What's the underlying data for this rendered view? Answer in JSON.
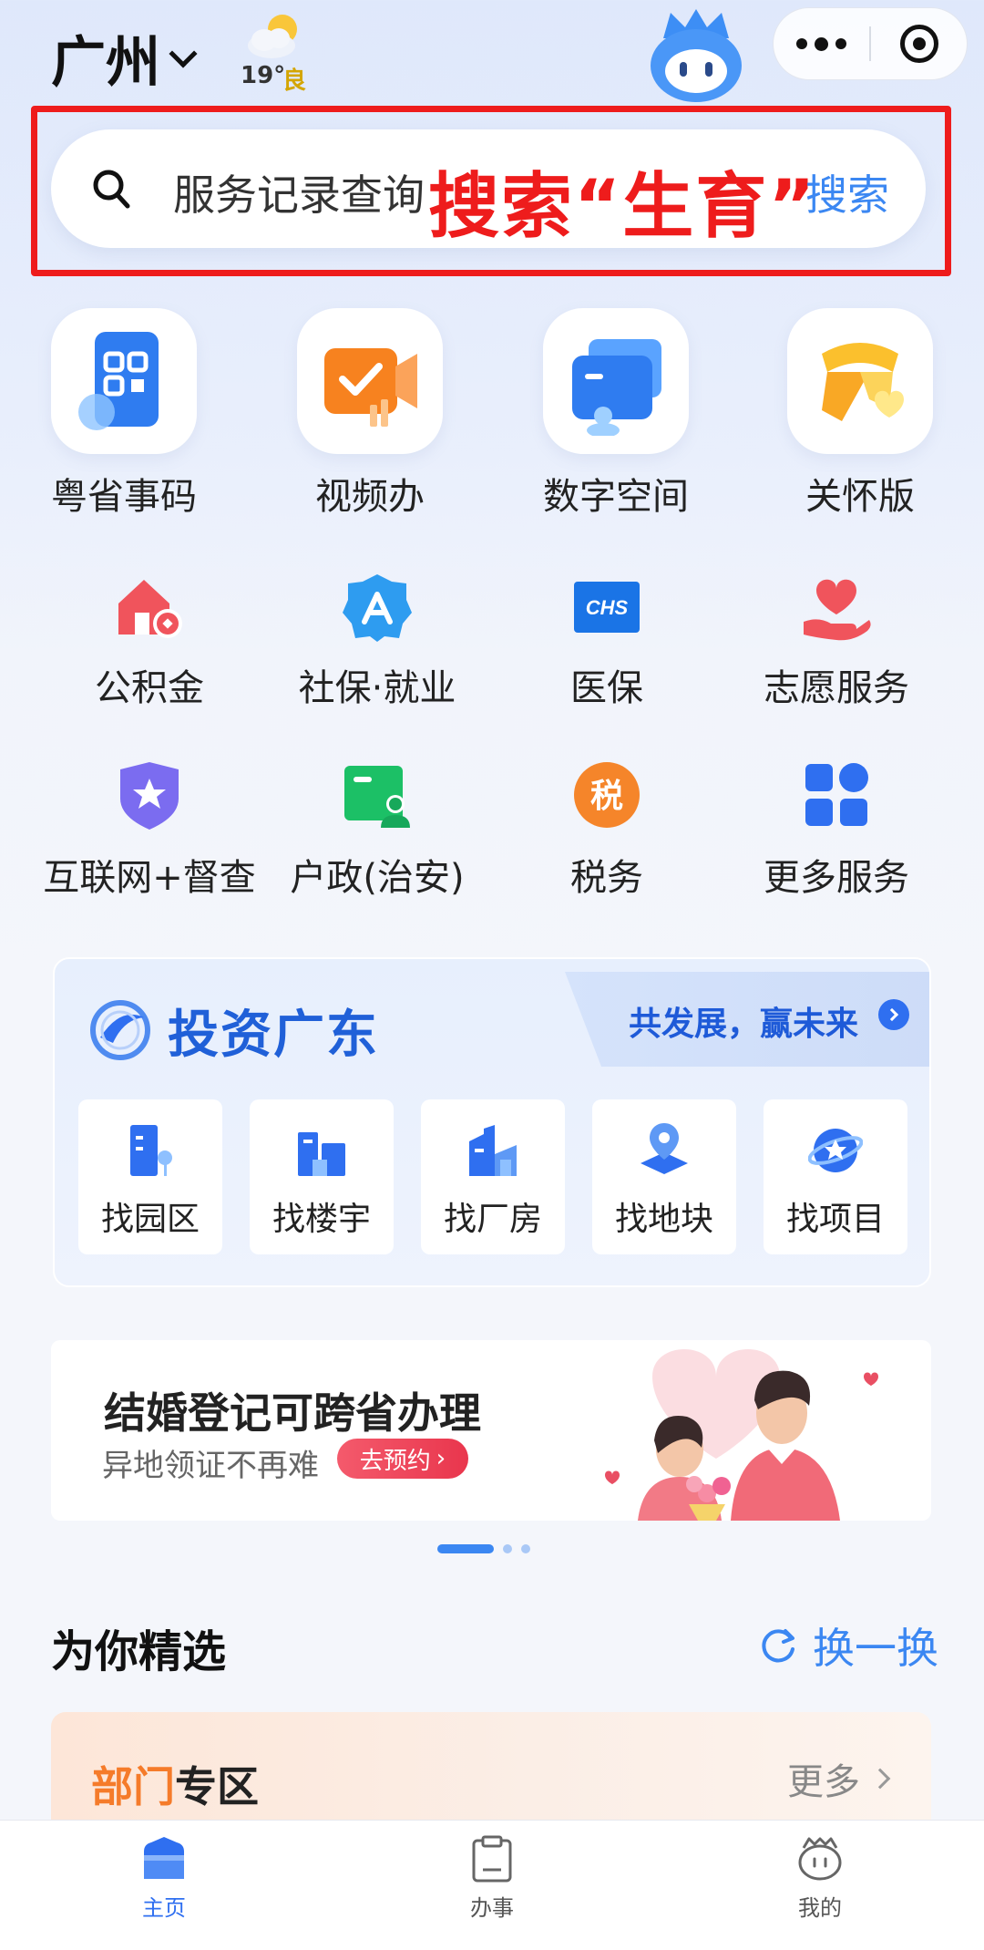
{
  "header": {
    "city": "广州",
    "weather_temp": "19°",
    "air_quality": "良"
  },
  "search": {
    "placeholder": "服务记录查询",
    "annotation": "搜索“生育”",
    "button_label": "搜索"
  },
  "quick_services": [
    {
      "label": "粤省事码",
      "icon": "qr-code-icon"
    },
    {
      "label": "视频办",
      "icon": "video-camera-icon"
    },
    {
      "label": "数字空间",
      "icon": "wallet-icon"
    },
    {
      "label": "关怀版",
      "icon": "scarf-heart-icon"
    }
  ],
  "services": [
    {
      "label": "公积金",
      "icon": "house-fund-icon",
      "color": "#f0545c"
    },
    {
      "label": "社保·就业",
      "icon": "social-security-icon",
      "color": "#2e9cf0"
    },
    {
      "label": "医保",
      "icon": "chs-icon",
      "color": "#1a74e6"
    },
    {
      "label": "志愿服务",
      "icon": "heart-hand-icon",
      "color": "#f0545c"
    },
    {
      "label": "互联网+督查",
      "icon": "shield-star-icon",
      "color": "#7b6cf0"
    },
    {
      "label": "户政(治安)",
      "icon": "id-card-icon",
      "color": "#1cc066"
    },
    {
      "label": "税务",
      "icon": "tax-icon",
      "color": "#f5852a",
      "glyph": "税"
    },
    {
      "label": "更多服务",
      "icon": "grid-icon",
      "color": "#2f6ff0"
    }
  ],
  "invest": {
    "title": "投资广东",
    "slogan": "共发展，赢未来",
    "items": [
      {
        "label": "找园区",
        "icon": "park-icon"
      },
      {
        "label": "找楼宇",
        "icon": "building-icon"
      },
      {
        "label": "找厂房",
        "icon": "factory-icon"
      },
      {
        "label": "找地块",
        "icon": "land-pin-icon"
      },
      {
        "label": "找项目",
        "icon": "project-icon"
      }
    ]
  },
  "banner": {
    "title": "结婚登记可跨省办理",
    "subtitle": "异地领证不再难",
    "cta": "去预约",
    "slide_count": 3,
    "active_slide": 1
  },
  "picks": {
    "title": "为你精选",
    "refresh_label": "换一换"
  },
  "department": {
    "label_highlight": "部门",
    "label_rest": "专区",
    "more_label": "更多"
  },
  "tabbar": [
    {
      "label": "主页",
      "icon": "home-icon",
      "active": true
    },
    {
      "label": "办事",
      "icon": "clipboard-icon",
      "active": false
    },
    {
      "label": "我的",
      "icon": "profile-face-icon",
      "active": false
    }
  ],
  "colors": {
    "accent": "#3b87f2",
    "annotation_red": "#ee1c1c",
    "invest_blue": "#2060d8",
    "dept_orange": "#f57b2a"
  }
}
